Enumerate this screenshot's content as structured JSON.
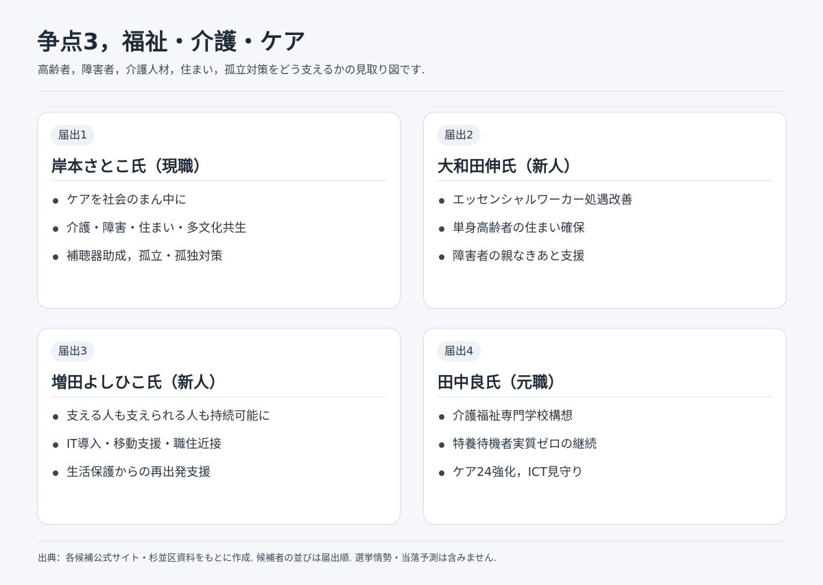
{
  "header": {
    "title": "争点3，福祉・介護・ケア",
    "subtitle": "高齢者，障害者，介護人材，住まい，孤立対策をどう支えるかの見取り図です."
  },
  "cards": [
    {
      "badge": "届出1",
      "name": "岸本さとこ氏（現職）",
      "points": [
        "ケアを社会のまん中に",
        "介護・障害・住まい・多文化共生",
        "補聴器助成，孤立・孤独対策"
      ]
    },
    {
      "badge": "届出2",
      "name": "大和田伸氏（新人）",
      "points": [
        "エッセンシャルワーカー処遇改善",
        "単身高齢者の住まい確保",
        "障害者の親なきあと支援"
      ]
    },
    {
      "badge": "届出3",
      "name": "増田よしひこ氏（新人）",
      "points": [
        "支える人も支えられる人も持続可能に",
        "IT導入・移動支援・職住近接",
        "生活保護からの再出発支援"
      ]
    },
    {
      "badge": "届出4",
      "name": "田中良氏（元職）",
      "points": [
        "介護福祉専門学校構想",
        "特養待機者実質ゼロの継続",
        "ケア24強化，ICT見守り"
      ]
    }
  ],
  "footer": {
    "note": "出典：各候補公式サイト・杉並区資料をもとに作成. 候補者の並びは届出順. 選挙情勢・当落予測は含みません."
  }
}
